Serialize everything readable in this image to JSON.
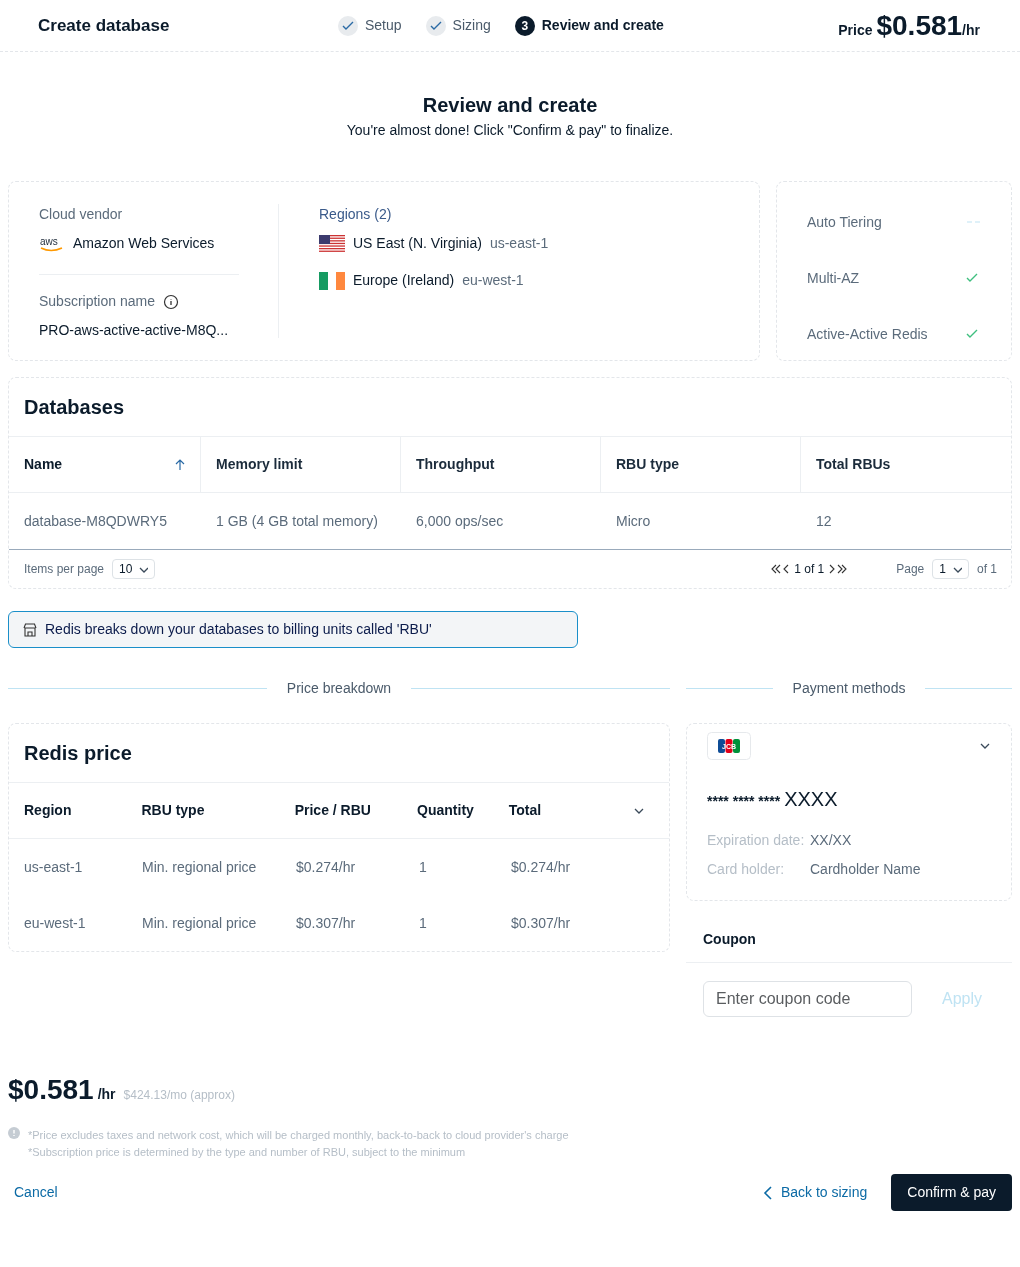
{
  "header": {
    "title": "Create database",
    "steps": [
      {
        "label": "Setup",
        "done": true,
        "selected": false
      },
      {
        "label": "Sizing",
        "done": true,
        "selected": false
      },
      {
        "label": "Review and create",
        "number": "3",
        "done": false,
        "selected": true
      }
    ],
    "price": {
      "label": "Price",
      "amount": "$0.581",
      "unit": "/hr"
    }
  },
  "intro": {
    "title": "Review and create",
    "subtitle": "You're almost done! Click \"Confirm & pay\" to finalize."
  },
  "summary": {
    "cloud_vendor": {
      "label": "Cloud vendor",
      "value": "Amazon Web Services",
      "logo": "aws"
    },
    "subscription": {
      "label": "Subscription name",
      "value": "PRO-aws-active-active-M8Q..."
    },
    "regions": {
      "label": "Regions (2)",
      "items": [
        {
          "name": "US East (N. Virginia)",
          "code": "us-east-1",
          "kind": "us"
        },
        {
          "name": "Europe (Ireland)",
          "code": "eu-west-1",
          "kind": "ie"
        }
      ]
    },
    "features": [
      {
        "label": "Auto Tiering",
        "enabled": false
      },
      {
        "label": "Multi-AZ",
        "enabled": true
      },
      {
        "label": "Active-Active Redis",
        "enabled": true
      }
    ]
  },
  "databases": {
    "title": "Databases",
    "columns": [
      {
        "label": "Name",
        "sorted": true
      },
      {
        "label": "Memory limit",
        "sorted": false
      },
      {
        "label": "Throughput",
        "sorted": false
      },
      {
        "label": "RBU type",
        "sorted": false
      },
      {
        "label": "Total RBUs",
        "sorted": false
      }
    ],
    "rows": [
      [
        "database-M8QDWRY5",
        "1 GB (4 GB total memory)",
        "6,000 ops/sec",
        "Micro",
        "12"
      ]
    ],
    "pagination": {
      "items_per_page_label": "Items per page",
      "items_per_page": "10",
      "range": "1 of 1",
      "page_label": "Page",
      "page": "1",
      "page_total": "of 1"
    }
  },
  "notice": "Redis breaks down your databases to billing units called 'RBU'",
  "price_breakdown": {
    "heading": "Price breakdown",
    "title": "Redis price",
    "expanded": false,
    "columns": [
      "Region",
      "RBU type",
      "Price / RBU",
      "Quantity",
      "Total"
    ],
    "rows": [
      [
        "us-east-1",
        "Min. regional price",
        "$0.274/hr",
        "1",
        "$0.274/hr"
      ],
      [
        "eu-west-1",
        "Min. regional price",
        "$0.307/hr",
        "1",
        "$0.307/hr"
      ]
    ]
  },
  "payment": {
    "heading": "Payment methods",
    "card_brand": "JCB",
    "masked": "**** **** ****",
    "last_digits": "XXXX",
    "expiration_label": "Expiration date:",
    "expiration": "XX/XX",
    "holder_label": "Card holder:",
    "holder": "Cardholder Name",
    "coupon": {
      "label": "Coupon",
      "placeholder": "Enter coupon code",
      "apply": "Apply",
      "apply_disabled": true
    }
  },
  "total": {
    "amount": "$0.581",
    "unit": "/hr",
    "monthly": "$424.13/mo (approx)",
    "notes": [
      "*Price excludes taxes and network cost, which will be charged monthly, back-to-back to cloud provider's charge",
      "*Subscription price is determined by the type and number of RBU, subject to the minimum"
    ]
  },
  "footer": {
    "cancel": "Cancel",
    "back": "Back to sizing",
    "confirm": "Confirm & pay"
  }
}
